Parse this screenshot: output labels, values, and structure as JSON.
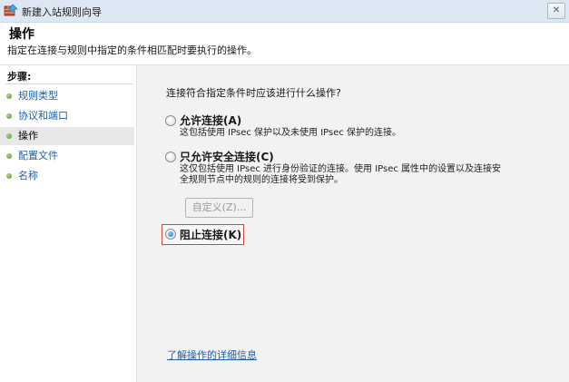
{
  "window": {
    "title": "新建入站规则向导",
    "close_label": "✕",
    "icon": "wizard-icon"
  },
  "header": {
    "title": "操作",
    "subtitle": "指定在连接与规则中指定的条件相匹配时要执行的操作。"
  },
  "sidebar": {
    "title": "步骤:",
    "steps": [
      {
        "label": "规则类型",
        "current": false
      },
      {
        "label": "协议和端口",
        "current": false
      },
      {
        "label": "操作",
        "current": true
      },
      {
        "label": "配置文件",
        "current": false
      },
      {
        "label": "名称",
        "current": false
      }
    ]
  },
  "main": {
    "question": "连接符合指定条件时应该进行什么操作?",
    "options": [
      {
        "label": "允许连接(A)",
        "description": "这包括使用 IPsec 保护以及未使用 IPsec 保护的连接。",
        "selected": false
      },
      {
        "label": "只允许安全连接(C)",
        "description_line1": "这仅包括使用 IPsec 进行身份验证的连接。使用 IPsec 属性中的设置以及连接安",
        "description_line2": "全规则节点中的规则的连接将受到保护。",
        "selected": false
      },
      {
        "label": "阻止连接(K)",
        "selected": true
      }
    ],
    "customize_button": "自定义(Z)...",
    "learn_more_link": "了解操作的详细信息"
  },
  "colors": {
    "link": "#1f5fa6",
    "highlight_border": "#d9443a",
    "content_bg": "#f2f2f2"
  }
}
